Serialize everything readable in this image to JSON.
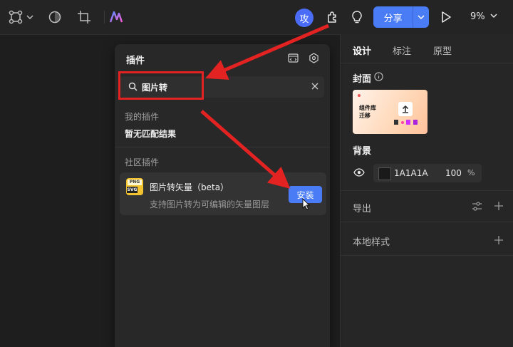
{
  "toolbar": {
    "avatar_text": "攻",
    "share_label": "分享",
    "zoom": "9%"
  },
  "plugin_panel": {
    "title": "插件",
    "search_value": "图片转",
    "my_plugins_label": "我的插件",
    "no_match_text": "暂无匹配结果",
    "community_label": "社区插件",
    "item": {
      "name": "图片转矢量（beta）",
      "description": "支持图片转为可编辑的矢量图层",
      "install_label": "安装",
      "logo_text_top": "PNG",
      "logo_text_bottom": "SVG"
    }
  },
  "right_panel": {
    "tabs": [
      "设计",
      "标注",
      "原型"
    ],
    "cover_label": "封面",
    "cover_thumb_text": "组件库\n迁移",
    "background_label": "背景",
    "bg_hex": "1A1A1A",
    "bg_opacity": "100",
    "bg_percent": "%",
    "export_label": "导出",
    "local_styles_label": "本地样式"
  },
  "colors": {
    "accent": "#4a7cf6",
    "annotation": "#e32222",
    "background": "#1e1e1e"
  }
}
